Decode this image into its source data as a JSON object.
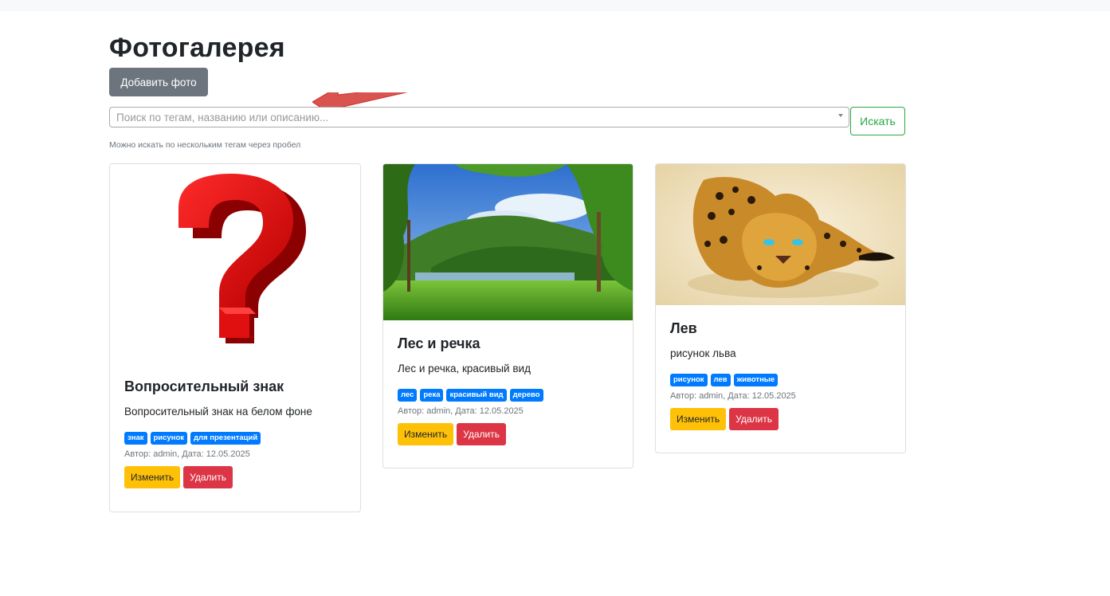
{
  "page": {
    "title": "Фотогалерея",
    "add_button": "Добавить фото"
  },
  "search": {
    "placeholder": "Поиск по тегам, названию или описанию...",
    "button": "Искать",
    "hint": "Можно искать по нескольким тегам через пробел"
  },
  "cards": [
    {
      "title": "Вопросительный знак",
      "description": "Вопросительный знак на белом фоне",
      "tags": [
        "знак",
        "рисунок",
        "для презентаций"
      ],
      "meta": "Автор: admin, Дата: 12.05.2025",
      "edit": "Изменить",
      "delete": "Удалить"
    },
    {
      "title": "Лес и речка",
      "description": "Лес и речка, красивый вид",
      "tags": [
        "лес",
        "река",
        "красивый вид",
        "дерево"
      ],
      "meta": "Автор: admin, Дата: 12.05.2025",
      "edit": "Изменить",
      "delete": "Удалить"
    },
    {
      "title": "Лев",
      "description": "рисунок льва",
      "tags": [
        "рисунок",
        "лев",
        "животные"
      ],
      "meta": "Автор: admin, Дата: 12.05.2025",
      "edit": "Изменить",
      "delete": "Удалить"
    }
  ],
  "colors": {
    "secondary": "#6c757d",
    "success": "#28a745",
    "primary": "#007bff",
    "warning": "#ffc107",
    "danger": "#dc3545",
    "arrow": "#d9534f"
  }
}
